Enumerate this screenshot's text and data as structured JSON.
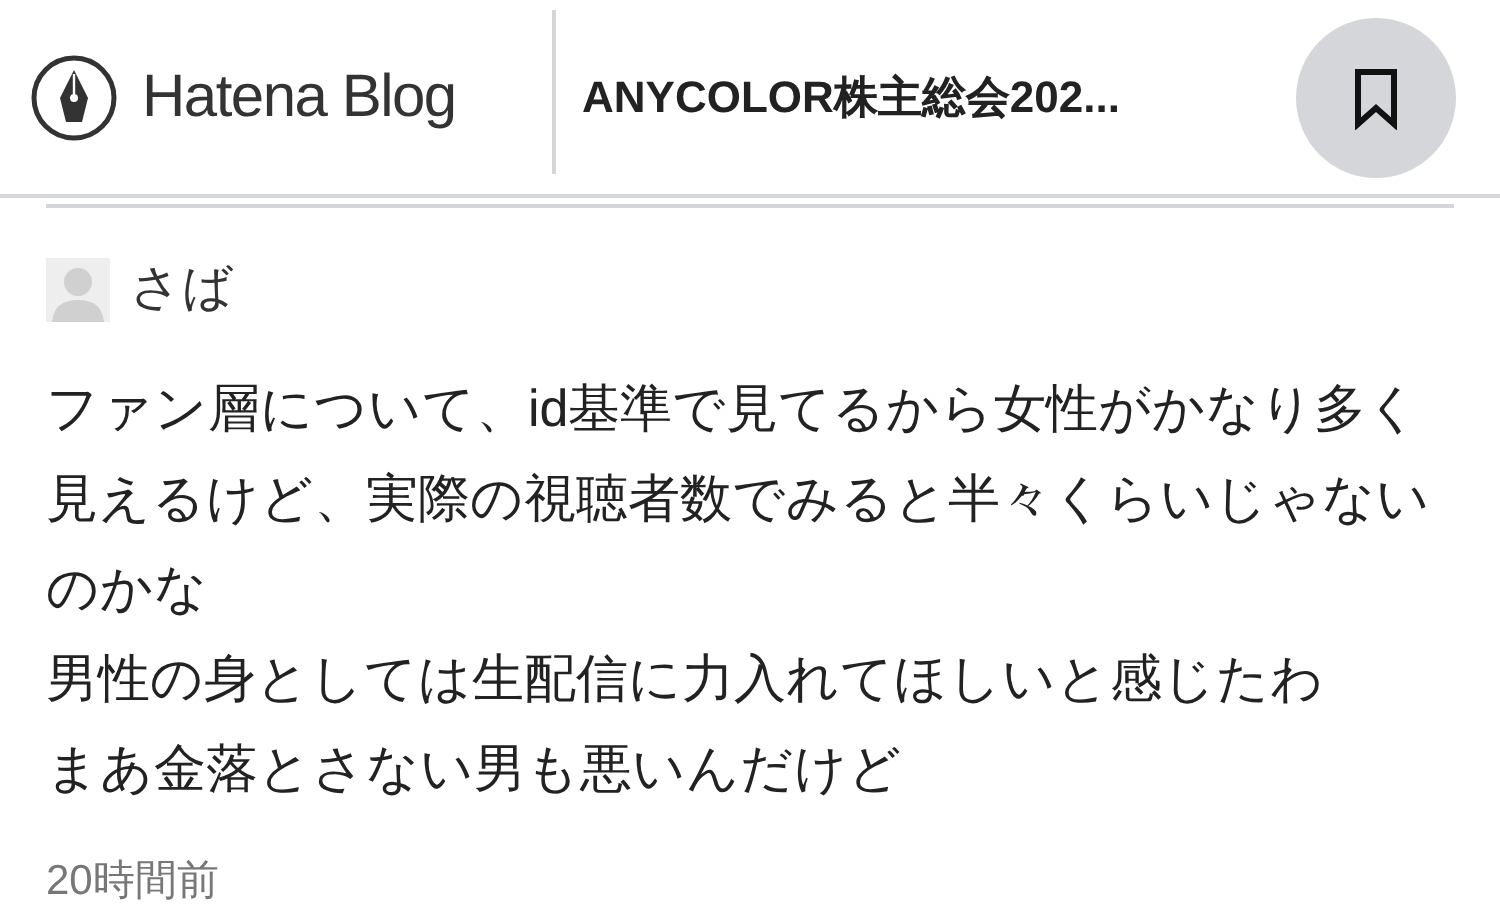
{
  "header": {
    "logo": "Hatena Blog",
    "title": "ANYCOLOR株主総会202..."
  },
  "comment": {
    "user": "さば",
    "lines": [
      "ファン層について、id基準で見てるから女性がかなり多く",
      "見えるけど、実際の視聴者数でみると半々くらいじゃない",
      "のかな",
      "男性の身としては生配信に力入れてほしいと感じたわ",
      "まあ金落とさない男も悪いんだけど"
    ],
    "time": "20時間前"
  }
}
